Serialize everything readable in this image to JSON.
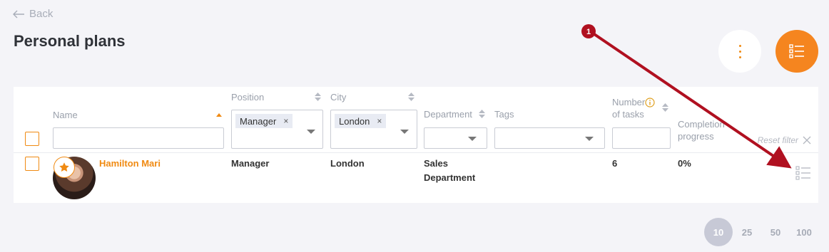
{
  "nav": {
    "back_label": "Back"
  },
  "page": {
    "title": "Personal plans"
  },
  "table": {
    "columns": {
      "name": "Name",
      "position": "Position",
      "city": "City",
      "department": "Department",
      "tags": "Tags",
      "tasks_line1": "Number",
      "tasks_line2": "of tasks",
      "progress_line1": "Completion",
      "progress_line2": "progress"
    },
    "filters": {
      "position_tag": "Manager",
      "city_tag": "London",
      "reset_label": "Reset filter"
    },
    "rows": [
      {
        "name": "Hamilton Mari",
        "position": "Manager",
        "city": "London",
        "department_line1": "Sales",
        "department_line2": "Department",
        "tasks": "6",
        "progress": "0%"
      }
    ]
  },
  "pagination": {
    "sizes": [
      "10",
      "25",
      "50",
      "100"
    ],
    "active": "10"
  },
  "annotation": {
    "marker": "1"
  },
  "colors": {
    "accent": "#f5851f",
    "arrow": "#b01020"
  }
}
